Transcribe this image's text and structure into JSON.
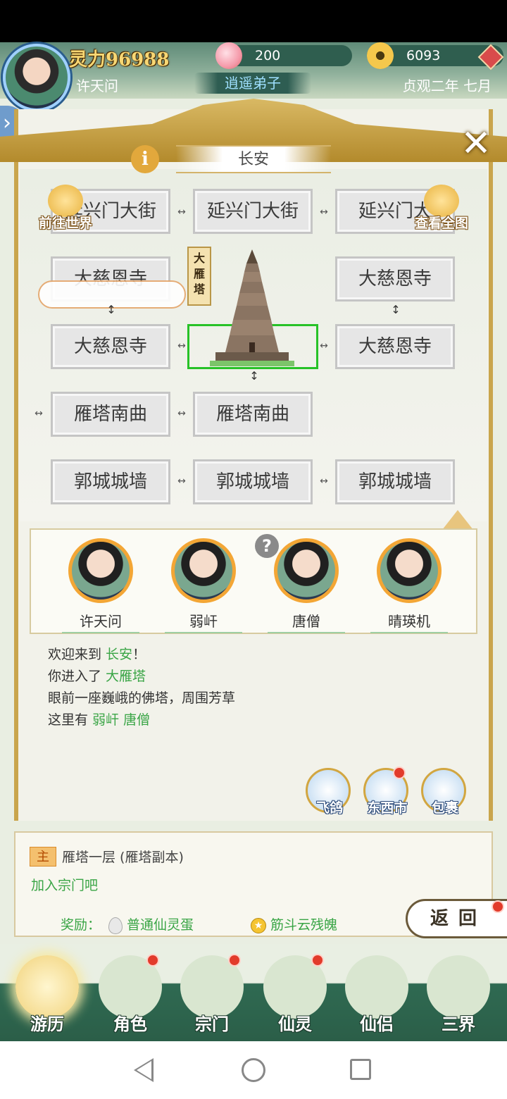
{
  "header": {
    "power": "灵力96988",
    "player_name": "许天问",
    "title_badge": "逍遥弟子",
    "date": "贞观二年 七月",
    "peach_count": "200",
    "coin_count": "6093"
  },
  "map": {
    "location_title": "长安",
    "goto_world_label": "前往世界",
    "view_full_map_label": "查看全图",
    "landmark_label": "大雁塔",
    "cells": [
      {
        "label": "延兴门大街",
        "display": "延兴门大街"
      },
      {
        "label": "延兴门大街",
        "display": "延兴门大街"
      },
      {
        "label": "延兴门大街",
        "display": "延兴门大"
      },
      {
        "label": "大慈恩寺",
        "display": "大慈恩寺"
      },
      {
        "label": "大慈恩寺",
        "display": "大慈恩寺"
      },
      {
        "label": "大慈恩寺",
        "display": "大慈恩寺"
      },
      {
        "label": "大慈恩寺",
        "display": "大慈恩寺"
      },
      {
        "label": "雁塔南曲",
        "display": "雁塔南曲"
      },
      {
        "label": "雁塔南曲",
        "display": "雁塔南曲"
      },
      {
        "label": "郭城城墙",
        "display": "郭城城墙"
      },
      {
        "label": "郭城城墙",
        "display": "郭城城墙"
      },
      {
        "label": "郭城城墙",
        "display": "郭城城墙"
      }
    ]
  },
  "npcs": [
    {
      "name": "许天问"
    },
    {
      "name": "弱屽"
    },
    {
      "name": "唐僧"
    },
    {
      "name": "晴瑛机"
    }
  ],
  "log": {
    "line1_prefix": "欢迎来到 ",
    "line1_place": "长安",
    "line1_suffix": "！",
    "line2_prefix": "你进入了 ",
    "line2_place": "大雁塔",
    "line3": "眼前一座巍峨的佛塔，周围芳草",
    "line4_prefix": "这里有 ",
    "line4_npc1": "弱屽",
    "line4_npc2": "唐僧"
  },
  "actions": {
    "pigeon": "飞鸽",
    "market": "东西市",
    "bag": "包裹"
  },
  "quest": {
    "tag": "主",
    "title": "雁塔一层 (雁塔副本)",
    "description": "加入宗门吧",
    "reward_label": "奖励：",
    "reward1": "普通仙灵蛋",
    "reward2": "筋斗云残魄"
  },
  "back_button": "返回",
  "bottom_nav": [
    {
      "label": "游历"
    },
    {
      "label": "角色"
    },
    {
      "label": "宗门"
    },
    {
      "label": "仙灵"
    },
    {
      "label": "仙侣"
    },
    {
      "label": "三界"
    }
  ],
  "colors": {
    "accent_green": "#3aa546",
    "gold": "#c9a54c",
    "notification_red": "#e23b2b"
  }
}
